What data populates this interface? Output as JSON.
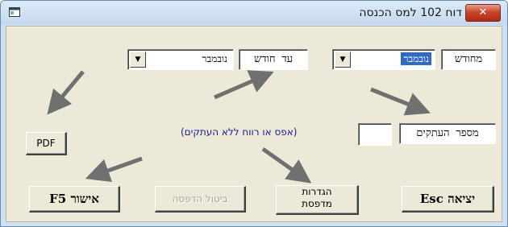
{
  "window": {
    "title": "דוח 102 למס הכנסה",
    "close_glyph": "✕"
  },
  "filters": {
    "from_month_label": "מחודש",
    "from_month_value": "נובמבר",
    "to_month_label": "עד חודש",
    "to_month_value": "נובמבר"
  },
  "print": {
    "copies_label": "מספר העתקים",
    "copies_value": "",
    "copies_hint": "(אפס או רווח ללא העתקים)"
  },
  "buttons": {
    "pdf": "PDF",
    "confirm": "אישור F5",
    "cancel_print": "ביטול הדפסה",
    "printer_settings_line1": "הגדרות",
    "printer_settings_line2": "מדפסת",
    "exit": "יציאה Esc"
  },
  "colors": {
    "arrow": "#707070",
    "selection": "#316ac5",
    "hint_text": "#1a1a8a"
  }
}
